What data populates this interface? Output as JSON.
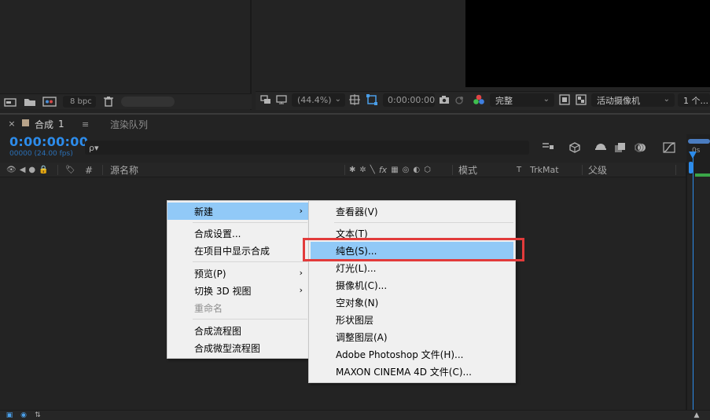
{
  "project_panel": {
    "bpc_label": "8 bpc",
    "icons": [
      "interpret-footage-icon",
      "folder-icon",
      "new-comp-icon",
      "trash-icon"
    ]
  },
  "viewer_toolbar": {
    "zoom": "(44.4%)",
    "timecode": "0:00:00:00",
    "resolution": "完整",
    "camera": "活动摄像机",
    "views": "1 个..."
  },
  "timeline": {
    "tabs": [
      {
        "label": "合成",
        "number": "1"
      },
      {
        "label": "渲染队列"
      }
    ],
    "current_time": "0:00:00:00",
    "frame_info": "00000 (24.00 fps)",
    "search_placeholder": "ρ▾",
    "columns": {
      "hash": "#",
      "source_name": "源名称",
      "mode": "模式",
      "t": "T",
      "trkmat": "TrkMat",
      "parent": "父级",
      "switches_fx": "fx"
    },
    "ruler_label": "0s"
  },
  "context_menu": {
    "items": [
      {
        "label": "新建",
        "submenu": true,
        "highlighted": true
      },
      {
        "label": "合成设置..."
      },
      {
        "label": "在项目中显示合成"
      },
      {
        "label": "预览(P)",
        "submenu": true
      },
      {
        "label": "切换 3D 视图",
        "submenu": true
      },
      {
        "label": "重命名",
        "disabled": true
      },
      {
        "label": "合成流程图"
      },
      {
        "label": "合成微型流程图"
      }
    ]
  },
  "submenu": {
    "items": [
      {
        "label": "查看器(V)"
      },
      {
        "label": "文本(T)"
      },
      {
        "label": "纯色(S)...",
        "highlighted": true
      },
      {
        "label": "灯光(L)..."
      },
      {
        "label": "摄像机(C)..."
      },
      {
        "label": "空对象(N)"
      },
      {
        "label": "形状图层"
      },
      {
        "label": "调整图层(A)"
      },
      {
        "label": "Adobe Photoshop 文件(H)..."
      },
      {
        "label": "MAXON CINEMA 4D 文件(C)..."
      }
    ]
  },
  "colors": {
    "accent_timecode": "#2d8ceb",
    "menu_highlight": "#91c9f7",
    "annotation_box": "#e23b3b"
  }
}
